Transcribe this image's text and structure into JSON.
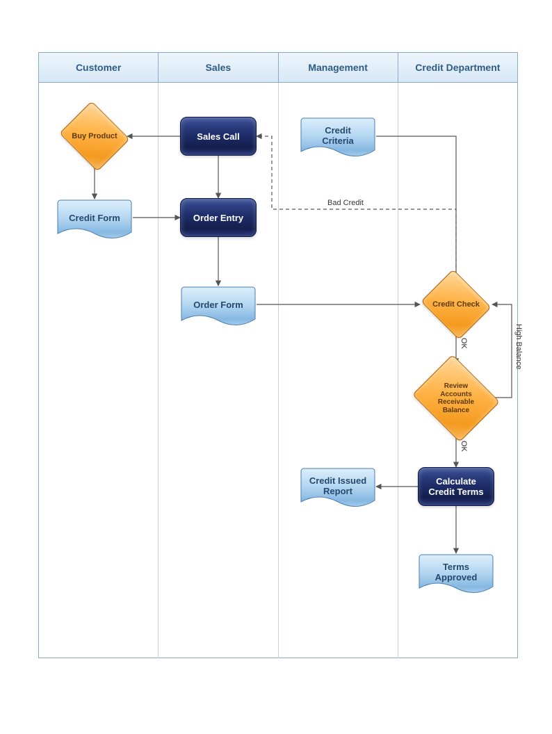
{
  "lanes": {
    "customer": "Customer",
    "sales": "Sales",
    "management": "Management",
    "credit": "Credit Department"
  },
  "nodes": {
    "buy_product": "Buy Product",
    "sales_call": "Sales Call",
    "credit_criteria": "Credit\nCriteria",
    "credit_form": "Credit Form",
    "order_entry": "Order Entry",
    "order_form": "Order Form",
    "credit_check": "Credit Check",
    "review_ar": "Review\nAccounts\nReceivable\nBalance",
    "calculate_terms": "Calculate\nCredit Terms",
    "credit_issued": "Credit Issued\nReport",
    "terms_approved": "Terms\nApproved"
  },
  "edge_labels": {
    "bad_credit": "Bad Credit",
    "ok1": "OK",
    "ok2": "OK",
    "high_balance": "High Balance"
  },
  "chart_data": {
    "type": "flowchart-swimlane",
    "lanes": [
      "Customer",
      "Sales",
      "Management",
      "Credit Department"
    ],
    "nodes": [
      {
        "id": "buy_product",
        "lane": "Customer",
        "shape": "decision",
        "label": "Buy Product"
      },
      {
        "id": "sales_call",
        "lane": "Sales",
        "shape": "process",
        "label": "Sales Call"
      },
      {
        "id": "credit_criteria",
        "lane": "Management",
        "shape": "document",
        "label": "Credit Criteria"
      },
      {
        "id": "credit_form",
        "lane": "Customer",
        "shape": "document",
        "label": "Credit Form"
      },
      {
        "id": "order_entry",
        "lane": "Sales",
        "shape": "process",
        "label": "Order Entry"
      },
      {
        "id": "order_form",
        "lane": "Sales",
        "shape": "document",
        "label": "Order Form"
      },
      {
        "id": "credit_check",
        "lane": "Credit Department",
        "shape": "decision",
        "label": "Credit Check"
      },
      {
        "id": "review_ar",
        "lane": "Credit Department",
        "shape": "decision",
        "label": "Review Accounts Receivable Balance"
      },
      {
        "id": "calculate_terms",
        "lane": "Credit Department",
        "shape": "process",
        "label": "Calculate Credit Terms"
      },
      {
        "id": "credit_issued",
        "lane": "Management",
        "shape": "document",
        "label": "Credit Issued Report"
      },
      {
        "id": "terms_approved",
        "lane": "Credit Department",
        "shape": "document",
        "label": "Terms Approved"
      }
    ],
    "edges": [
      {
        "from": "sales_call",
        "to": "buy_product"
      },
      {
        "from": "buy_product",
        "to": "credit_form"
      },
      {
        "from": "credit_form",
        "to": "order_entry"
      },
      {
        "from": "sales_call",
        "to": "order_entry"
      },
      {
        "from": "order_entry",
        "to": "order_form"
      },
      {
        "from": "order_form",
        "to": "credit_check"
      },
      {
        "from": "credit_criteria",
        "to": "credit_check"
      },
      {
        "from": "credit_check",
        "to": "sales_call",
        "label": "Bad Credit",
        "style": "dashed"
      },
      {
        "from": "credit_check",
        "to": "review_ar",
        "label": "OK"
      },
      {
        "from": "review_ar",
        "to": "credit_check",
        "label": "High Balance"
      },
      {
        "from": "review_ar",
        "to": "calculate_terms",
        "label": "OK"
      },
      {
        "from": "calculate_terms",
        "to": "credit_issued"
      },
      {
        "from": "calculate_terms",
        "to": "terms_approved"
      }
    ]
  }
}
